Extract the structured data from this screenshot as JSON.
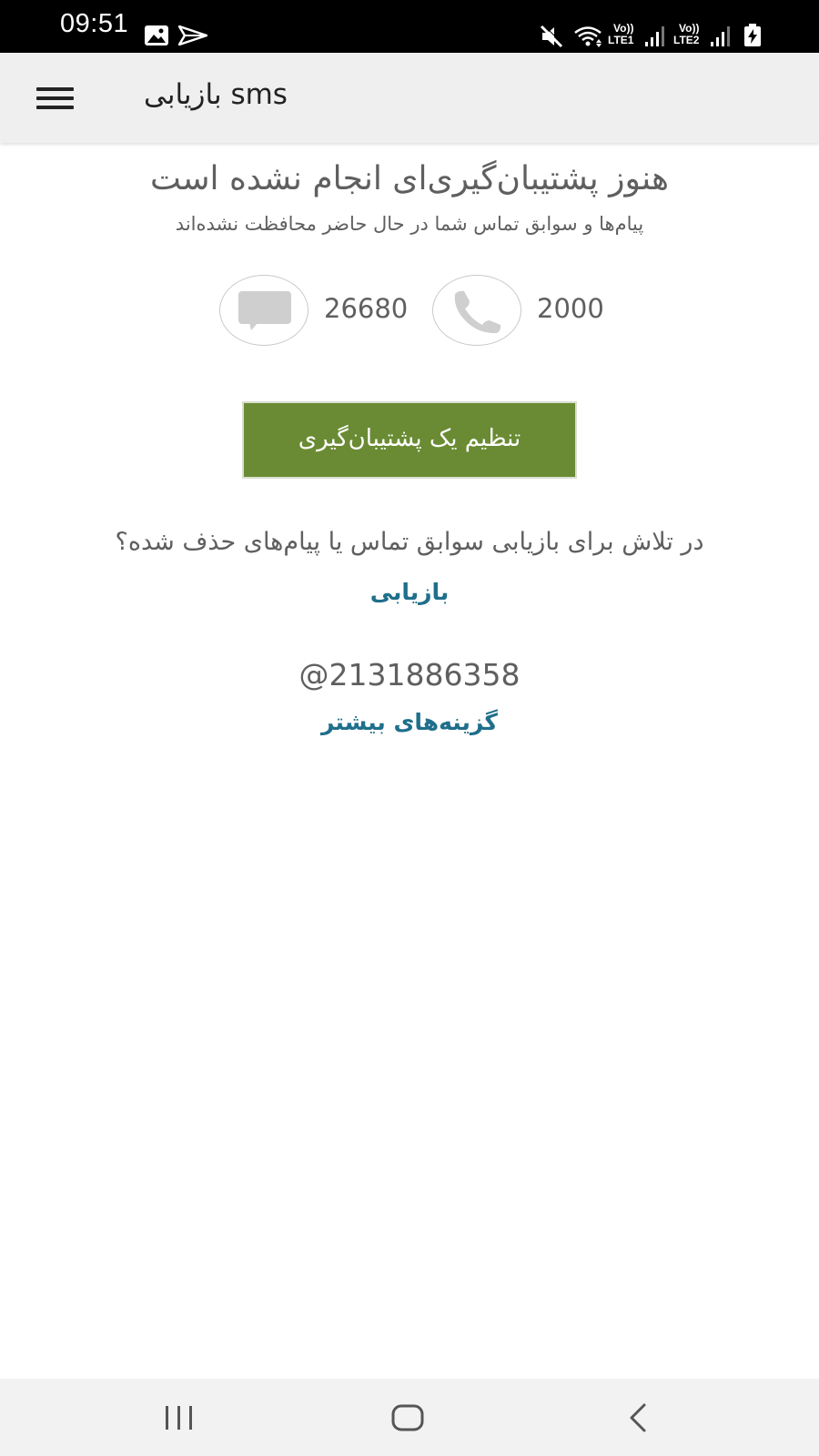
{
  "status_bar": {
    "time": "09:51",
    "icons": [
      "image-icon",
      "send-icon",
      "mute-icon",
      "wifi-icon",
      "lte1-signal-icon",
      "lte2-signal-icon",
      "battery-charging-icon"
    ],
    "lte1_label": "LTE1",
    "lte2_label": "LTE2",
    "volte_label": "Vo))"
  },
  "app_bar": {
    "title": "بازیابی sms",
    "menu_icon": "hamburger-menu-icon"
  },
  "main": {
    "heading": "هنوز پشتیبان‌گیری‌ای انجام نشده است",
    "subheading": "پیام‌ها و سوابق تماس شما در حال حاضر محافظت نشده‌اند",
    "messages_count": "26680",
    "calls_count": "2000",
    "backup_button_label": "تنظیم یک پشتیبان‌گیری",
    "restore_question": "در تلاش برای بازیابی سوابق تماس یا پیام‌های حذف شده؟",
    "restore_link": "بازیابی",
    "account": "@2131886358",
    "more_options_link": "گزینه‌های بیشتر"
  },
  "nav_bar": {
    "icons": [
      "recent-apps-icon",
      "home-icon",
      "back-icon"
    ]
  },
  "colors": {
    "accent_green": "#6a8b33",
    "link_blue": "#1f6f8b",
    "text_gray": "#5f5f5f",
    "app_bar_bg": "#efefef"
  }
}
